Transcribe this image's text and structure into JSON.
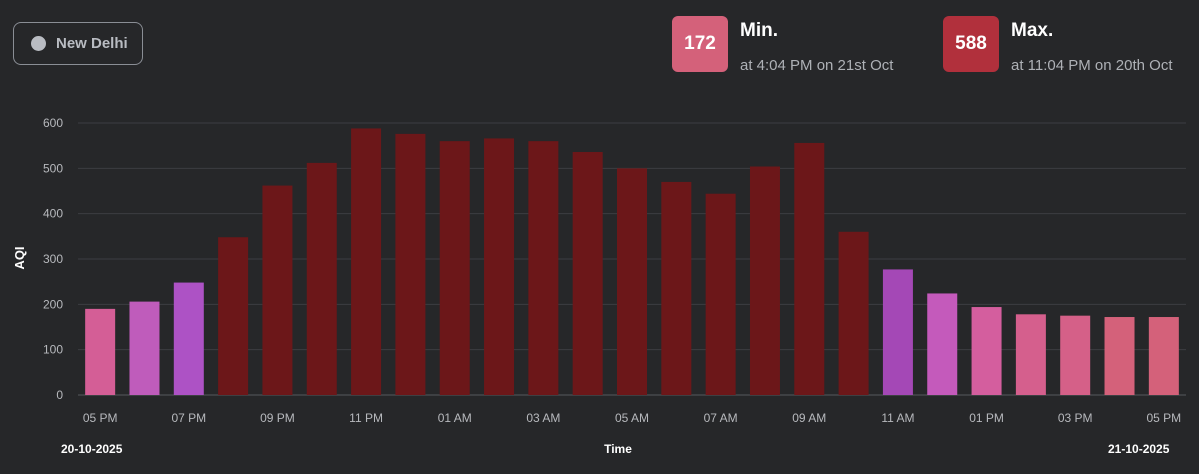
{
  "location": {
    "name": "New Delhi"
  },
  "summary": {
    "min": {
      "value": "172",
      "title": "Min.",
      "subtitle": "at 4:04 PM on 21st Oct",
      "color": "#d4617a"
    },
    "max": {
      "value": "588",
      "title": "Max.",
      "subtitle": "at 11:04 PM on 20th Oct",
      "color": "#b1303c"
    }
  },
  "footer": {
    "start_date": "20-10-2025",
    "end_date": "21-10-2025"
  },
  "chart_data": {
    "type": "bar",
    "xlabel": "Time",
    "ylabel": "AQI",
    "ylim": [
      0,
      600
    ],
    "yticks": [
      0,
      100,
      200,
      300,
      400,
      500,
      600
    ],
    "grid": true,
    "categories": [
      "05 PM",
      "06 PM",
      "07 PM",
      "08 PM",
      "09 PM",
      "10 PM",
      "11 PM",
      "12 AM",
      "01 AM",
      "02 AM",
      "03 AM",
      "04 AM",
      "05 AM",
      "06 AM",
      "07 AM",
      "08 AM",
      "09 AM",
      "10 AM",
      "11 AM",
      "12 PM",
      "01 PM",
      "02 PM",
      "03 PM",
      "04 PM",
      "05 PM"
    ],
    "tick_labels": [
      "05 PM",
      "",
      "07 PM",
      "",
      "09 PM",
      "",
      "11 PM",
      "",
      "01 AM",
      "",
      "03 AM",
      "",
      "05 AM",
      "",
      "07 AM",
      "",
      "09 AM",
      "",
      "11 AM",
      "",
      "01 PM",
      "",
      "03 PM",
      "",
      "05 PM"
    ],
    "values": [
      190,
      206,
      248,
      348,
      462,
      512,
      588,
      576,
      560,
      566,
      560,
      536,
      500,
      470,
      444,
      504,
      556,
      360,
      277,
      224,
      194,
      178,
      175,
      172,
      172
    ],
    "colors": [
      "#d45e96",
      "#bf5cbb",
      "#ad52c5",
      "#6c1719",
      "#6c1719",
      "#6c1719",
      "#6c1719",
      "#6c1719",
      "#6c1719",
      "#6c1719",
      "#6c1719",
      "#6c1719",
      "#6c1719",
      "#6c1719",
      "#6c1719",
      "#6c1719",
      "#6c1719",
      "#6c1719",
      "#a448b6",
      "#c45abb",
      "#d45e9e",
      "#d55f8d",
      "#d56088",
      "#d4617a",
      "#d4617a"
    ]
  }
}
